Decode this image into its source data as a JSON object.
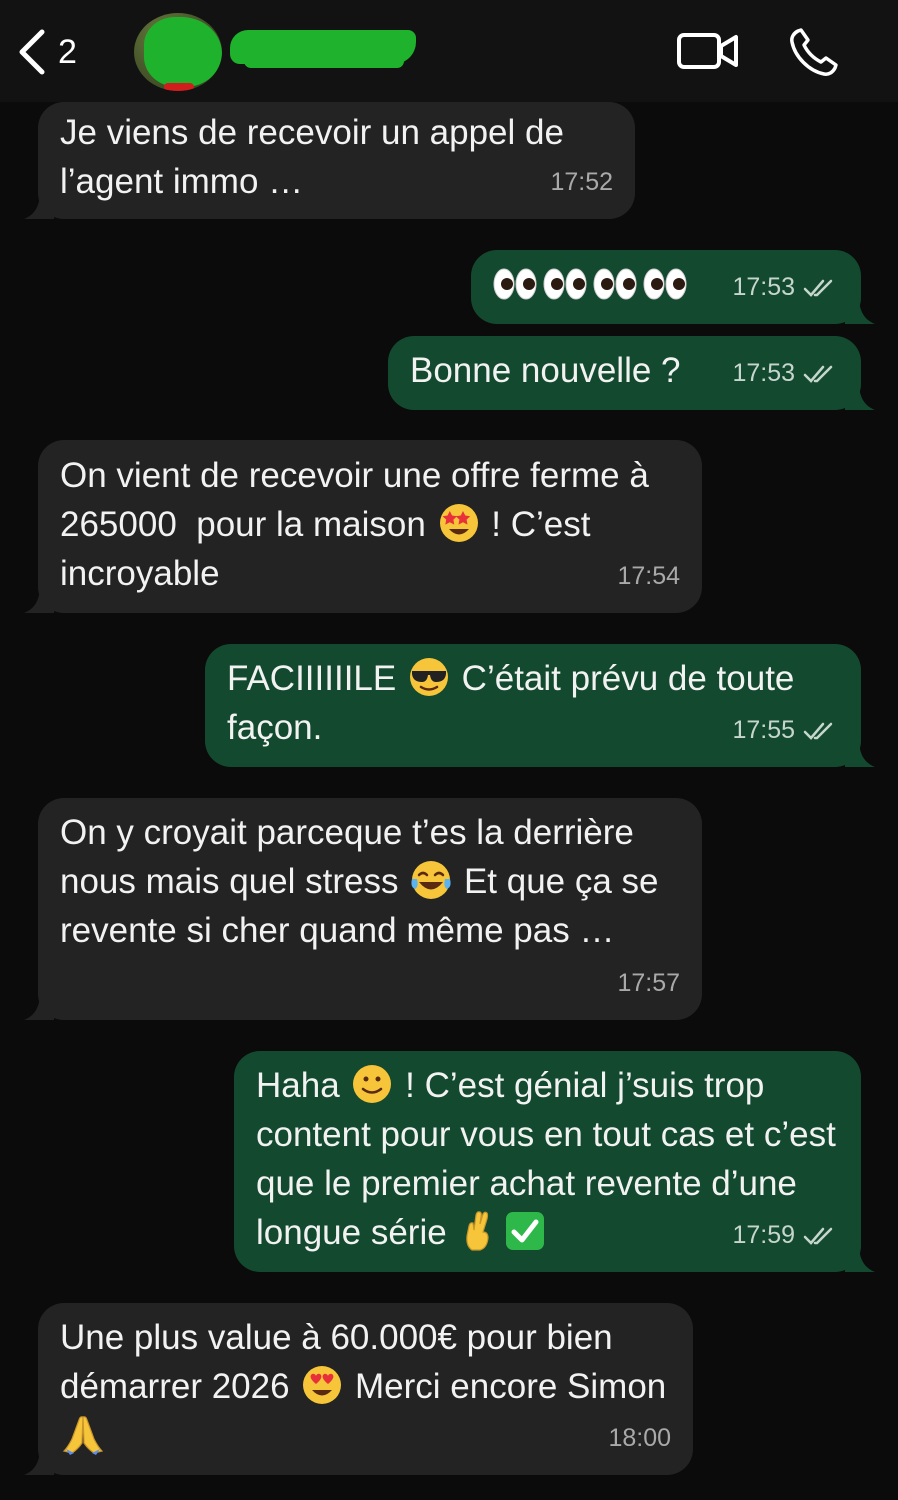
{
  "header": {
    "back_count": "2",
    "icons": {
      "back": "chevron-left-icon",
      "video": "video-camera-icon",
      "call": "phone-icon"
    }
  },
  "colors": {
    "background": "#0b0b0b",
    "incoming_bubble": "#232323",
    "outgoing_bubble": "#134a2f",
    "redaction": "#1fb32d"
  },
  "messages": [
    {
      "direction": "in",
      "text": "Je viens de recevoir un appel de l’agent immo …",
      "time": "17:52"
    },
    {
      "direction": "out",
      "text": "👀👀👀👀",
      "time": "17:53"
    },
    {
      "direction": "out",
      "text": "Bonne nouvelle ?",
      "time": "17:53"
    },
    {
      "direction": "in",
      "text_a": "On vient de recevoir une offre ferme à 265000  pour la maison ",
      "emoji": "star-struck-emoji",
      "text_b": " ! C’est incroyable",
      "time": "17:54"
    },
    {
      "direction": "out",
      "text_a": "FACIIIIIILE ",
      "emoji": "sunglasses-emoji",
      "text_b": " C’était prévu de toute façon.",
      "time": "17:55"
    },
    {
      "direction": "in",
      "text_a": "On y croyait parceque t’es la derrière nous mais quel stress ",
      "emoji": "tears-of-joy-emoji",
      "text_b": " Et que ça se revente si cher quand même pas …",
      "time": "17:57"
    },
    {
      "direction": "out",
      "text_a": "Haha ",
      "emoji": "slight-smile-emoji",
      "text_b": " ! C’est génial j’suis trop content pour vous en tout cas et c’est que le premier achat revente d’une longue série ",
      "emoji2": "crossed-fingers-emoji",
      "emoji3": "check-mark-emoji",
      "time": "17:59"
    },
    {
      "direction": "in",
      "text_a": "Une plus value à 60.000€ pour bien démarrer 2026 ",
      "emoji": "heart-eyes-emoji",
      "text_b": " Merci encore Simon ",
      "emoji2": "folded-hands-emoji",
      "time": "18:00"
    }
  ]
}
